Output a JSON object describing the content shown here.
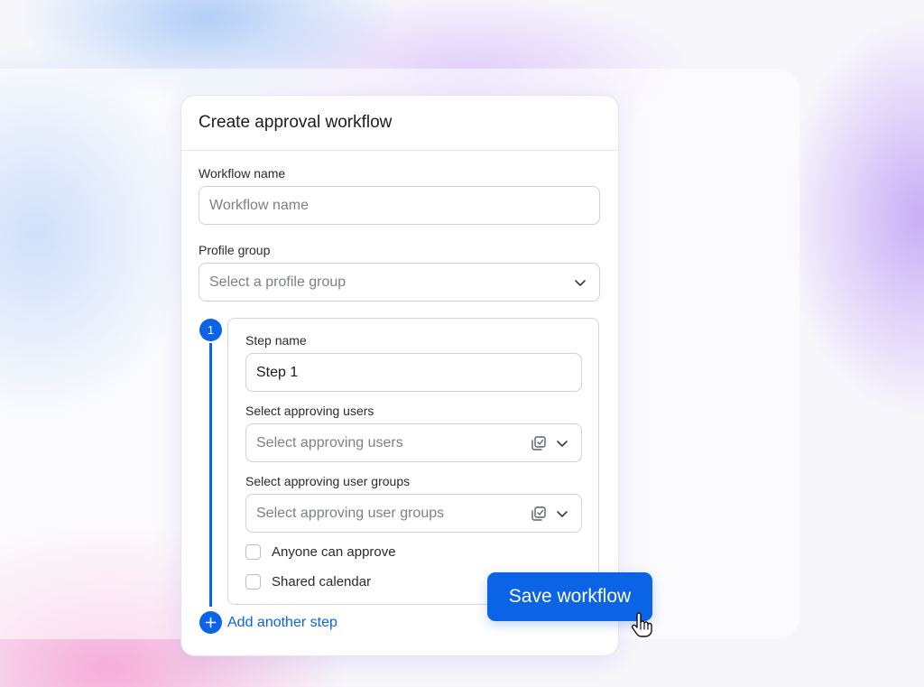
{
  "dialog": {
    "title": "Create approval workflow"
  },
  "workflow_name": {
    "label": "Workflow name",
    "placeholder": "Workflow name",
    "value": ""
  },
  "profile_group": {
    "label": "Profile group",
    "placeholder": "Select a profile group",
    "icon": "chevron-down-icon"
  },
  "step": {
    "number": "1",
    "step_name_label": "Step name",
    "step_name_value": "Step 1",
    "approving_users_label": "Select approving users",
    "approving_users_placeholder": "Select approving users",
    "approving_groups_label": "Select approving user groups",
    "approving_groups_placeholder": "Select approving user groups",
    "checkboxes": [
      {
        "label": "Anyone can approve",
        "checked": false
      },
      {
        "label": "Shared calendar",
        "checked": false
      }
    ]
  },
  "add_step_label": "Add another step",
  "save_button_label": "Save workflow",
  "colors": {
    "accent": "#0b63e5",
    "border": "#cfd1d8",
    "placeholder_text": "#7e8089"
  }
}
